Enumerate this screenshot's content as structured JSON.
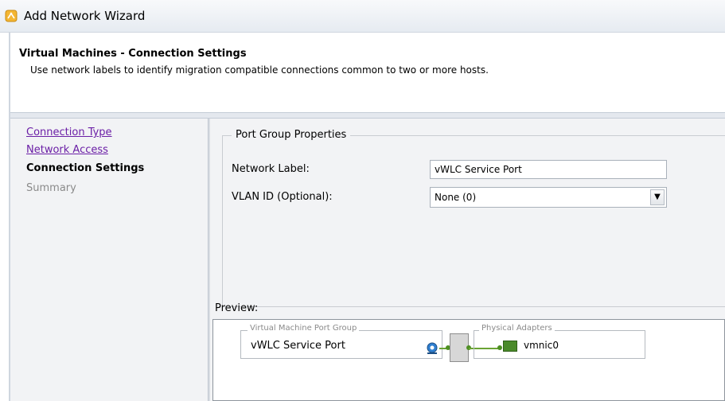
{
  "window": {
    "title": "Add Network Wizard"
  },
  "header": {
    "title": "Virtual Machines - Connection Settings",
    "description": "Use network labels to identify migration compatible connections common to two or more hosts."
  },
  "nav": {
    "items": [
      {
        "label": "Connection Type"
      },
      {
        "label": "Network Access"
      },
      {
        "label": "Connection Settings"
      },
      {
        "label": "Summary"
      }
    ]
  },
  "port_group": {
    "legend": "Port Group Properties",
    "network_label": {
      "label": "Network Label:",
      "value": "vWLC Service Port"
    },
    "vlan": {
      "label": "VLAN ID (Optional):",
      "value": "None (0)"
    }
  },
  "preview": {
    "label": "Preview:",
    "vm_port_group": {
      "legend": "Virtual Machine Port Group",
      "name": "vWLC Service Port"
    },
    "physical_adapters": {
      "legend": "Physical Adapters",
      "nic": "vmnic0"
    }
  },
  "colors": {
    "link": "#6b1fa6",
    "accent_green": "#4a8a2a"
  }
}
